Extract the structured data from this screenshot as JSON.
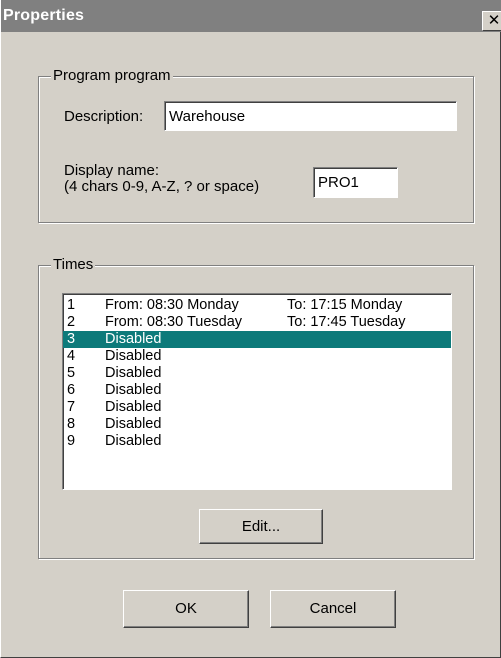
{
  "window": {
    "title": "Properties",
    "close_glyph": "✕"
  },
  "program_group": {
    "legend": "Program program",
    "description_label": "Description:",
    "description_value": "Warehouse",
    "display_name_label": "Display name:",
    "display_name_hint": "(4 chars 0-9, A-Z, ? or space)",
    "display_name_value": "PRO1"
  },
  "times_group": {
    "legend": "Times",
    "selected_index": 2,
    "rows": [
      {
        "num": "1",
        "from": "From: 08:30  Monday",
        "to": "To: 17:15  Monday"
      },
      {
        "num": "2",
        "from": "From: 08:30  Tuesday",
        "to": "To: 17:45  Tuesday"
      },
      {
        "num": "3",
        "from": "Disabled",
        "to": ""
      },
      {
        "num": "4",
        "from": "Disabled",
        "to": ""
      },
      {
        "num": "5",
        "from": "Disabled",
        "to": ""
      },
      {
        "num": "6",
        "from": "Disabled",
        "to": ""
      },
      {
        "num": "7",
        "from": "Disabled",
        "to": ""
      },
      {
        "num": "8",
        "from": "Disabled",
        "to": ""
      },
      {
        "num": "9",
        "from": "Disabled",
        "to": ""
      }
    ],
    "edit_label": "Edit..."
  },
  "footer": {
    "ok_label": "OK",
    "cancel_label": "Cancel"
  },
  "colors": {
    "face": "#d4d0c8",
    "titlebar": "#808080",
    "selection": "#0d7a7a"
  }
}
